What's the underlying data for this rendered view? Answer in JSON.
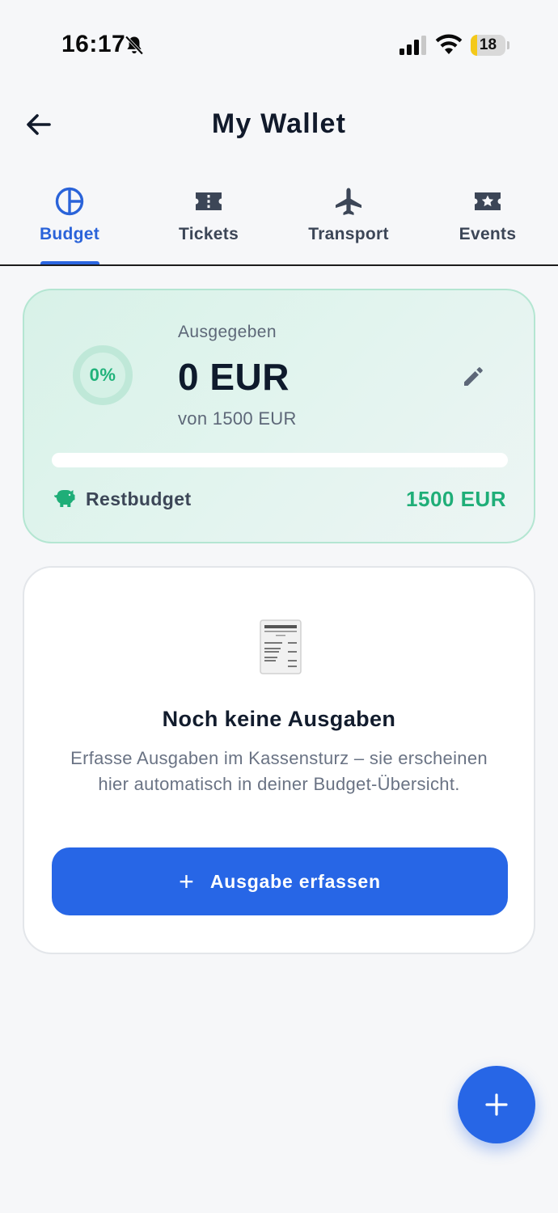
{
  "status_bar": {
    "time": "16:17",
    "battery_level": "18",
    "battery_fraction": 0.18,
    "bell_icon": "bell-slash-icon",
    "signal_icon": "cellular-signal-icon",
    "wifi_icon": "wifi-icon"
  },
  "header": {
    "title": "My Wallet",
    "back_icon": "arrow-left-icon"
  },
  "tabs": [
    {
      "label": "Budget",
      "icon": "pie-chart-icon",
      "active": true
    },
    {
      "label": "Tickets",
      "icon": "ticket-icon",
      "active": false
    },
    {
      "label": "Transport",
      "icon": "airplane-icon",
      "active": false
    },
    {
      "label": "Events",
      "icon": "star-ticket-icon",
      "active": false
    }
  ],
  "budget": {
    "percent_label": "0%",
    "spent_fraction": 0,
    "spent_label": "Ausgegeben",
    "spent_amount": "0 EUR",
    "budget_of": "von 1500 EUR",
    "edit_icon": "pencil-icon",
    "rest_icon": "piggy-bank-icon",
    "rest_label": "Restbudget",
    "rest_value": "1500 EUR"
  },
  "empty_state": {
    "icon": "receipt-icon",
    "title": "Noch keine Ausgaben",
    "description": "Erfasse Ausgaben im Kassensturz – sie erscheinen hier automatisch in deiner Budget-Übersicht.",
    "button_label": "Ausgabe erfassen",
    "button_icon": "plus-icon"
  },
  "fab": {
    "icon": "plus-icon"
  },
  "colors": {
    "accent": "#2766e6",
    "success": "#1fae78",
    "background": "#f6f7f9"
  }
}
